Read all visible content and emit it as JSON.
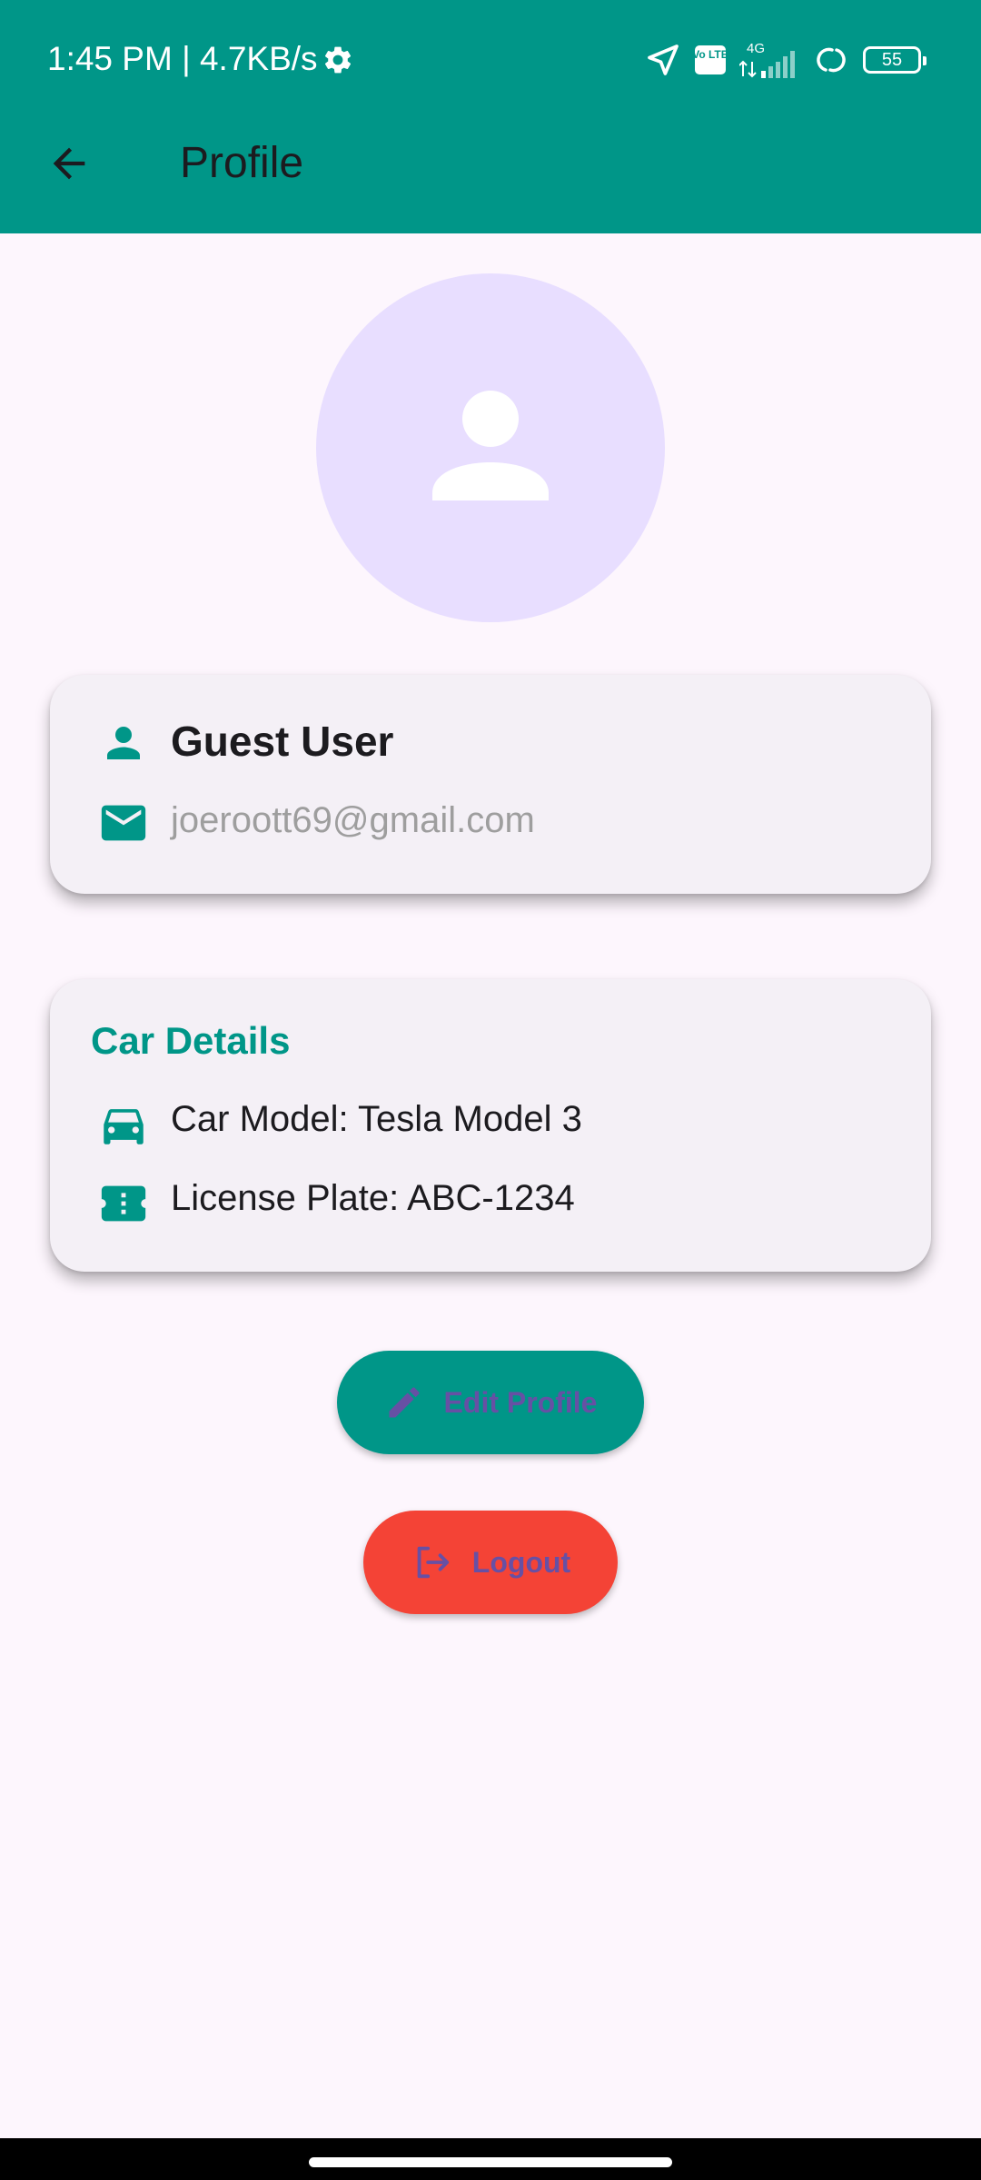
{
  "status_bar": {
    "time_speed": "1:45 PM | 4.7KB/s",
    "network_label": "4G",
    "volte_label": "Vo LTE",
    "battery": "55"
  },
  "app_bar": {
    "title": "Profile",
    "color": "#009688"
  },
  "profile": {
    "name": "Guest User",
    "email": "joeroott69@gmail.com"
  },
  "car_details": {
    "title": "Car Details",
    "model": "Car Model: Tesla Model 3",
    "plate": "License Plate: ABC-1234"
  },
  "actions": {
    "edit_label": "Edit Profile",
    "logout_label": "Logout"
  },
  "colors": {
    "primary": "#009688",
    "danger": "#F44336",
    "avatar_bg": "#E8DEFF",
    "button_text": "#6750A4"
  },
  "icons": {
    "back": "arrow-back-icon",
    "avatar": "person-icon",
    "name": "person-icon",
    "email": "mail-icon",
    "car": "car-icon",
    "plate": "ticket-icon",
    "edit": "pencil-icon",
    "logout": "logout-icon"
  }
}
